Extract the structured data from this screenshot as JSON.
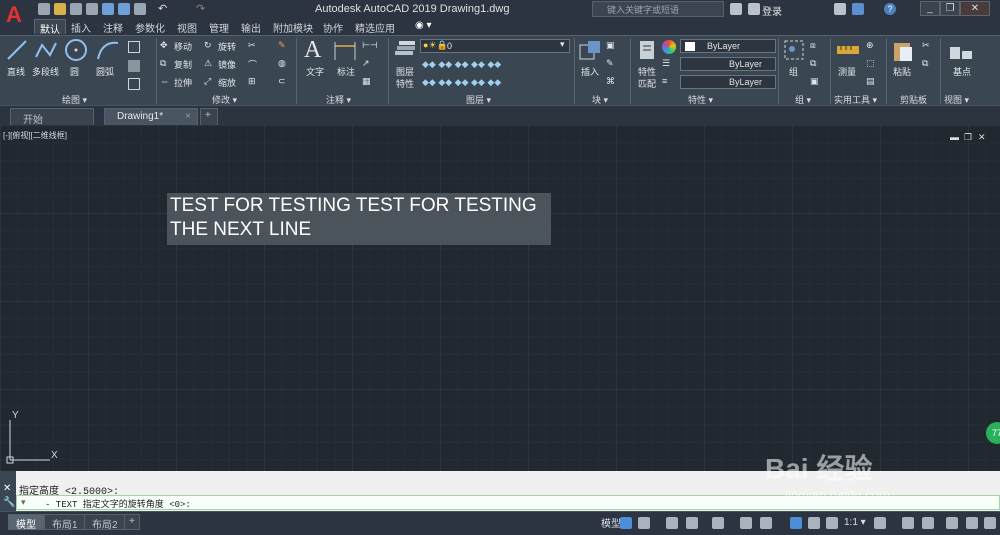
{
  "titlebar": {
    "app_logo": "A",
    "title": "Autodesk AutoCAD 2019    Drawing1.dwg",
    "search_placeholder": "键入关键字或短语",
    "login": "登录",
    "help": "?"
  },
  "ribbon_tabs": [
    "默认",
    "插入",
    "注释",
    "参数化",
    "视图",
    "管理",
    "输出",
    "附加模块",
    "协作",
    "精选应用"
  ],
  "panels": {
    "draw": {
      "title": "绘图 ▾",
      "line": "直线",
      "polyline": "多段线",
      "circle": "圆",
      "arc": "圆弧"
    },
    "modify": {
      "title": "修改 ▾",
      "move": "移动",
      "rotate": "旋转",
      "copy": "复制",
      "mirror": "镜像",
      "stretch": "拉伸",
      "scale": "缩放"
    },
    "annotation": {
      "title": "注释 ▾",
      "text": "文字",
      "dimension": "标注"
    },
    "layers": {
      "title": "图层 ▾",
      "layer_props_1": "图层",
      "layer_props_2": "特性",
      "current_layer": "0"
    },
    "block": {
      "title": "块 ▾",
      "insert": "插入"
    },
    "properties": {
      "title": "特性 ▾",
      "match_1": "特性",
      "match_2": "匹配",
      "color": "ByLayer",
      "linetype": "ByLayer",
      "lineweight": "ByLayer"
    },
    "groups": {
      "title": "组 ▾",
      "group": "组"
    },
    "utilities": {
      "title": "实用工具 ▾",
      "measure": "测量"
    },
    "clipboard": {
      "title": "剪贴板",
      "paste": "粘贴"
    },
    "view": {
      "title": "视图 ▾",
      "base": "基点"
    }
  },
  "doc_tabs": {
    "start": "开始",
    "drawing": "Drawing1*",
    "close": "×",
    "add": "+"
  },
  "canvas": {
    "viewport_label": "[-][俯视][二维线框]",
    "text_line_1": "TEST FOR TESTING TEST FOR TESTING",
    "text_line_2": "THE NEXT LINE",
    "ucs_x": "X",
    "ucs_y": "Y",
    "badge": "77"
  },
  "command": {
    "history": "指定高度 <2.5000>:",
    "prompt": "- TEXT 指定文字的旋转角度 <0>:"
  },
  "status": {
    "tabs": [
      "模型",
      "布局1",
      "布局2"
    ],
    "add": "+",
    "model_button": "模型",
    "scale": "1:1 ▾"
  },
  "watermark": {
    "main": "Bai 经验",
    "sub": "jingyan.baidu.com"
  }
}
